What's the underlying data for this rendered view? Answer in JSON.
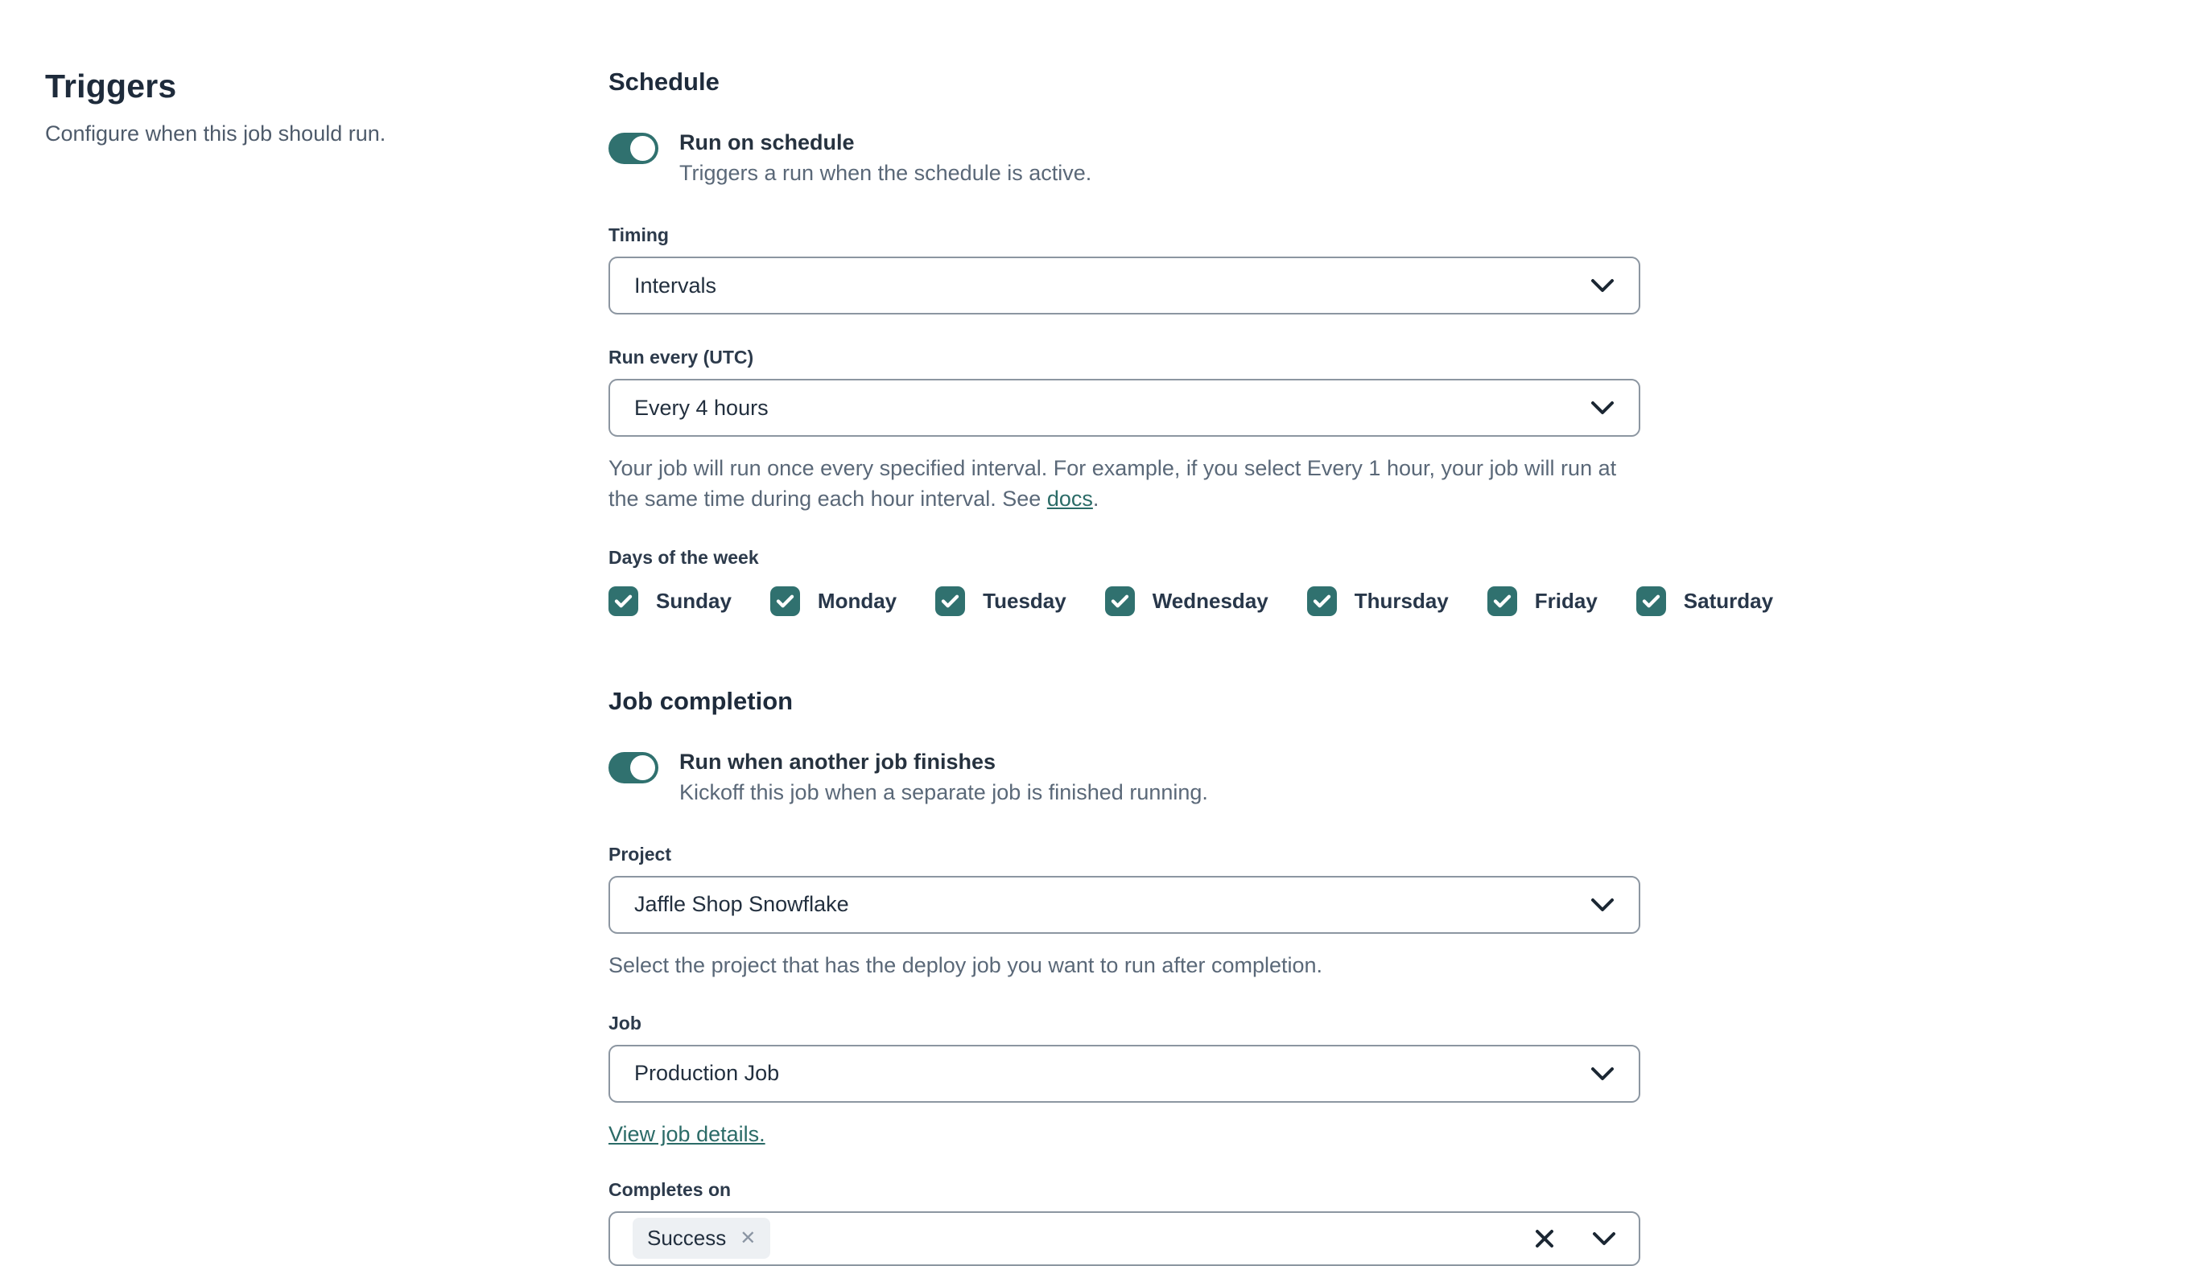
{
  "colors": {
    "accent_teal": "#30716F",
    "link_teal": "#2B6B67",
    "heading": "#1E2B3B",
    "body_text": "#222F3E",
    "muted_text": "#5A6878",
    "field_border": "#8C96A1",
    "chip_background": "#EDF0F3",
    "page_background": "#FFFFFF"
  },
  "left_panel": {
    "title": "Triggers",
    "subtitle": "Configure when this job should run."
  },
  "schedule": {
    "heading": "Schedule",
    "toggle": {
      "label": "Run on schedule",
      "description": "Triggers a run when the schedule is active.",
      "state": "on"
    },
    "timing": {
      "label": "Timing",
      "value": "Intervals"
    },
    "run_every": {
      "label": "Run every (UTC)",
      "value": "Every 4 hours",
      "help_before": "Your job will run once every specified interval. For example, if you select Every 1 hour, your job will run at the same time during each hour interval. See ",
      "help_link": "docs",
      "help_after": "."
    },
    "days": {
      "label": "Days of the week",
      "items": [
        {
          "label": "Sunday",
          "checked": true
        },
        {
          "label": "Monday",
          "checked": true
        },
        {
          "label": "Tuesday",
          "checked": true
        },
        {
          "label": "Wednesday",
          "checked": true
        },
        {
          "label": "Thursday",
          "checked": true
        },
        {
          "label": "Friday",
          "checked": true
        },
        {
          "label": "Saturday",
          "checked": true
        }
      ]
    }
  },
  "job_completion": {
    "heading": "Job completion",
    "toggle": {
      "label": "Run when another job finishes",
      "description": "Kickoff this job when a separate job is finished running.",
      "state": "on"
    },
    "project": {
      "label": "Project",
      "value": "Jaffle Shop Snowflake",
      "help": "Select the project that has the deploy job you want to run after completion."
    },
    "job": {
      "label": "Job",
      "value": "Production Job",
      "link_label": "View job details."
    },
    "completes_on": {
      "label": "Completes on",
      "chips": [
        {
          "label": "Success"
        }
      ]
    }
  },
  "icons": {
    "chevron_down": "chevron-down-icon",
    "checkmark": "checkmark-icon",
    "clear": "clear-x-icon",
    "chip_remove": "remove-chip-icon",
    "toggle_knob": "toggle-knob"
  }
}
